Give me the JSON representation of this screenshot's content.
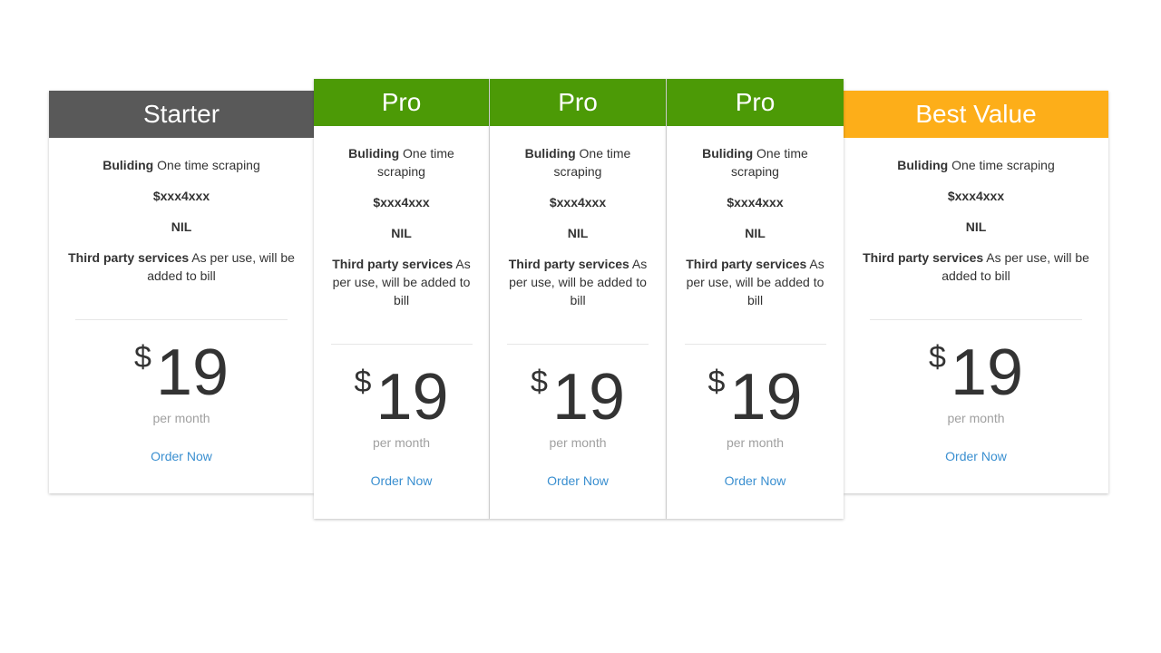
{
  "plans": [
    {
      "title": "Starter",
      "header_color": "#595959",
      "features": {
        "building_label": "Buliding",
        "building_value": "One time scraping",
        "price_code": "$xxx4xxx",
        "nil": "NIL",
        "third_party_label": "Third party services",
        "third_party_value": "As per use, will be added to bill"
      },
      "currency": "$",
      "price": "19",
      "period": "per month",
      "order_label": "Order Now"
    },
    {
      "title": "Pro",
      "header_color": "#4c9a06",
      "features": {
        "building_label": "Buliding",
        "building_value": "One time scraping",
        "price_code": "$xxx4xxx",
        "nil": "NIL",
        "third_party_label": "Third party services",
        "third_party_value": "As per use, will be added to bill"
      },
      "currency": "$",
      "price": "19",
      "period": "per month",
      "order_label": "Order Now"
    },
    {
      "title": "Pro",
      "header_color": "#4c9a06",
      "features": {
        "building_label": "Buliding",
        "building_value": "One time scraping",
        "price_code": "$xxx4xxx",
        "nil": "NIL",
        "third_party_label": "Third party services",
        "third_party_value": "As per use, will be added to bill"
      },
      "currency": "$",
      "price": "19",
      "period": "per month",
      "order_label": "Order Now"
    },
    {
      "title": "Pro",
      "header_color": "#4c9a06",
      "features": {
        "building_label": "Buliding",
        "building_value": "One time scraping",
        "price_code": "$xxx4xxx",
        "nil": "NIL",
        "third_party_label": "Third party services",
        "third_party_value": "As per use, will be added to bill"
      },
      "currency": "$",
      "price": "19",
      "period": "per month",
      "order_label": "Order Now"
    },
    {
      "title": "Best Value",
      "header_color": "#fdae19",
      "features": {
        "building_label": "Buliding",
        "building_value": "One time scraping",
        "price_code": "$xxx4xxx",
        "nil": "NIL",
        "third_party_label": "Third party services",
        "third_party_value": "As per use, will be added to bill"
      },
      "currency": "$",
      "price": "19",
      "period": "per month",
      "order_label": "Order Now"
    }
  ]
}
